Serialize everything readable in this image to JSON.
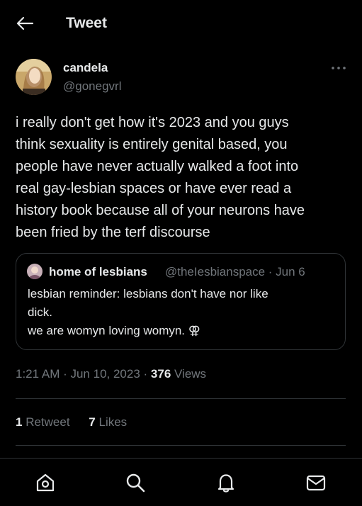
{
  "header": {
    "title": "Tweet",
    "back_icon": "arrow-left-icon"
  },
  "tweet": {
    "author_name": "candela",
    "author_handle": "@gonegvrl",
    "more_icon": "more-horizontal-icon",
    "text": "i really don't get how it's 2023 and you guys\nthink sexuality is entirely genital based, you\npeople have never actually walked a foot into\nreal gay-lesbian spaces or have ever read a\nhistory book because all of your neurons have\nbeen fried by the terf discourse",
    "quote": {
      "name": "home of lesbians",
      "handle_date": "@theIesbianspace · Jun 6",
      "text": "lesbian reminder: lesbians don't have nor like\ndick.\nwe are womyn loving womyn. ⚢"
    },
    "time": "1:21 AM · Jun 10, 2023 · ",
    "views_count": "376",
    "views_label": " Views",
    "retweets_count": "1",
    "retweets_label": " Retweet",
    "likes_count": "7",
    "likes_label": " Likes"
  },
  "nav": {
    "items": [
      {
        "name": "home",
        "icon": "home-icon"
      },
      {
        "name": "search",
        "icon": "search-icon"
      },
      {
        "name": "notifications",
        "icon": "bell-icon"
      },
      {
        "name": "messages",
        "icon": "mail-icon"
      }
    ]
  },
  "colors": {
    "background": "#000000",
    "text": "#e7e9ea",
    "secondary": "#71767b",
    "border": "#2f3336"
  }
}
